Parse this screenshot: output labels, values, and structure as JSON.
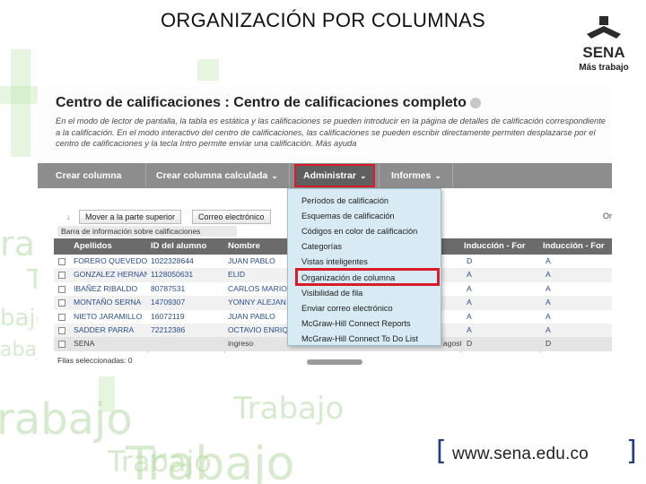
{
  "slide": {
    "title": "ORGANIZACIÓN POR COLUMNAS",
    "logo_text": "SENA",
    "logo_caption": "Más trabajo",
    "url": "www.sena.edu.co",
    "bracket_open": "[",
    "bracket_close": "]",
    "background_words": [
      "Trabajo",
      "Trabajo",
      "rabajo",
      "Trabajo",
      "ra",
      "T",
      "bajo",
      "abaj",
      "bajo"
    ]
  },
  "colors": {
    "nav_bar": "#8d8d8d",
    "nav_active": "#5f5f5f",
    "highlight": "#d81c2a",
    "menu_bg": "#d8ebf4",
    "link": "#2a4e8e",
    "logo_green": "#2b2b2b",
    "bracket": "#1f3f87"
  },
  "page": {
    "heading": "Centro de calificaciones : Centro de calificaciones completo",
    "heading_icon": "chevron-down-icon",
    "description": "En el modo de lector de pantalla, la tabla es estática y las calificaciones se pueden introducir en la página de detalles de calificación correspondiente a la calificación. En el modo interactivo del centro de calificaciones, las calificaciones se pueden escribir directamente permiten desplazarse por el centro de calificaciones y la tecla Intro permite enviar una calificación. Más ayuda"
  },
  "nav": {
    "items": [
      "Crear columna",
      "Crear columna calculada",
      "Administrar",
      "Informes"
    ],
    "caret": "⌄"
  },
  "toolbar": {
    "move_top": "Mover a la parte superior",
    "email": "Correo electrónico",
    "arrow": "↓",
    "right_cut": "Or"
  },
  "info_bar": "Barra de información sobre calificaciones",
  "grid": {
    "columns": [
      "Apellidos",
      "ID del alumno",
      "Nombre",
      "Inducción - For",
      "Inducción - For"
    ],
    "rows": [
      {
        "last": "FORERO QUEVEDO",
        "id": "1022328644",
        "first": "JUAN PABLO",
        "c1": "D",
        "c2": "A"
      },
      {
        "last": "GONZALEZ HERNAND",
        "id": "1128050631",
        "first": "ELID",
        "c1": "A",
        "c2": "A"
      },
      {
        "last": "IBAÑEZ RIBALDO",
        "id": "80787531",
        "first": "CARLOS MARIO",
        "c1": "A",
        "c2": "A"
      },
      {
        "last": "MONTAÑO SERNA",
        "id": "14709307",
        "first": "YONNY ALEJAN",
        "c1": "A",
        "c2": "A"
      },
      {
        "last": "NIETO JARAMILLO",
        "id": "16072119",
        "first": "JUAN PABLO",
        "c1": "A",
        "c2": "A"
      },
      {
        "last": "SADDER PARRA",
        "id": "72212386",
        "first": "OCTAVIO ENRIQ",
        "c1": "A",
        "c2": "A"
      },
      {
        "last": "SENA",
        "id": "",
        "first": "ingreso",
        "date": "27 de agosto de 20",
        "c1": "D",
        "c2": "D"
      }
    ],
    "footer": "Filas seleccionadas: 0"
  },
  "menu": {
    "items": [
      "Períodos de calificación",
      "Esquemas de calificación",
      "Códigos en color de calificación",
      "Categorías",
      "Vistas inteligentes",
      "Organización de columna",
      "Visibilidad de fila",
      "Enviar correo electrónico",
      "McGraw-Hill Connect Reports",
      "McGraw-Hill Connect To Do List"
    ]
  }
}
